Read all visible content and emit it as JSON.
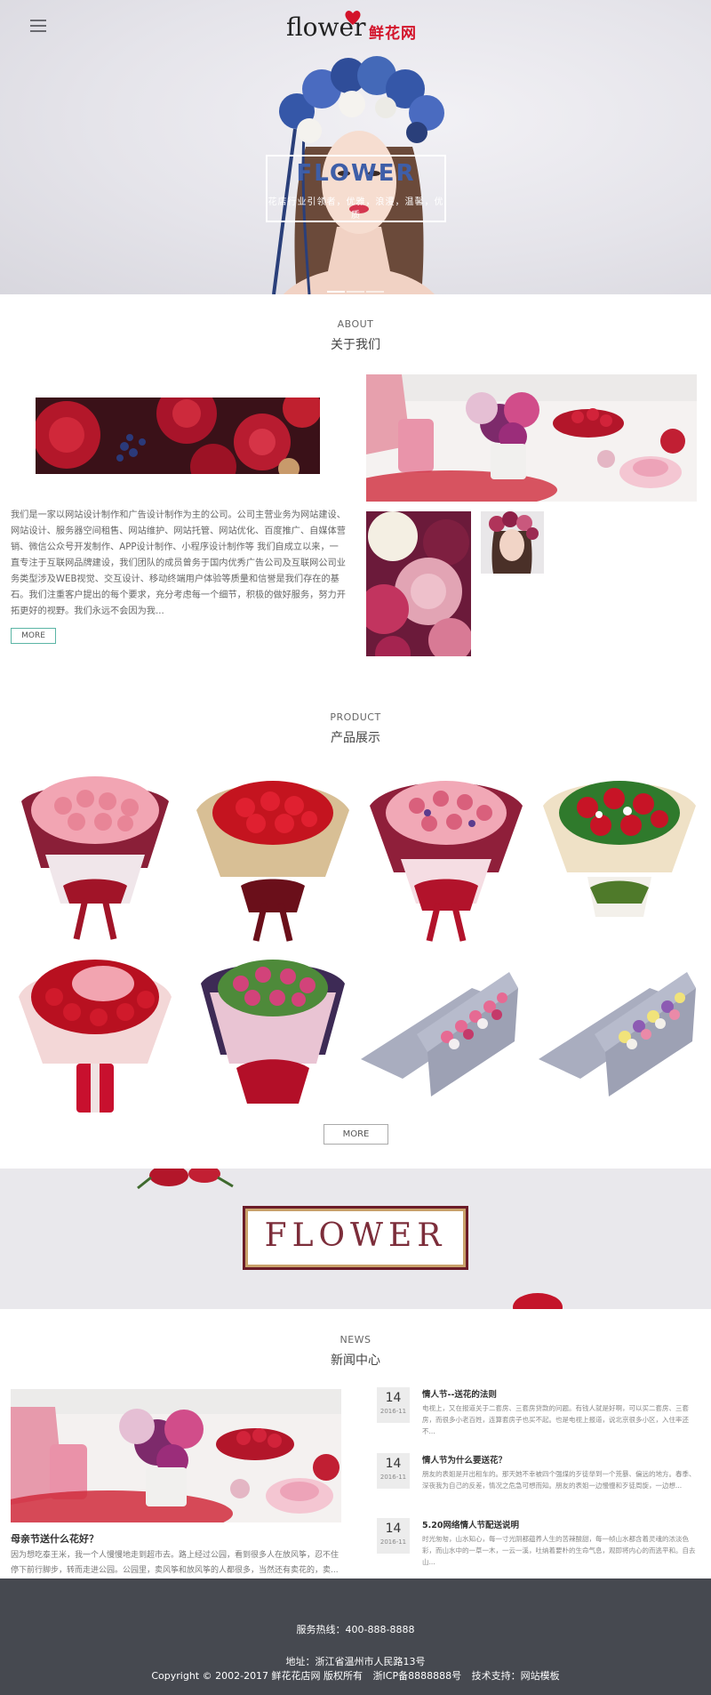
{
  "header": {
    "logo_latin": "flower",
    "logo_cn": "鲜花网",
    "colors": {
      "logo_red": "#d3132a"
    }
  },
  "hero": {
    "caption_title": "FLOWER",
    "caption_sub": "花店行业引领者，优雅，浪漫，温馨，优质",
    "slides": 3,
    "active_slide": 1
  },
  "about": {
    "heading_en": "ABOUT",
    "heading_cn": "关于我们",
    "text": "我们是一家以网站设计制作和广告设计制作为主的公司。公司主营业务为网站建设、网站设计、服务器空间租售、网站维护、网站托管、网站优化、百度推广、自媒体营销、微信公众号开发制作、APP设计制作、小程序设计制作等 我们自成立以来，一直专注于互联网品牌建设，我们团队的成员曾务于国内优秀广告公司及互联网公司业务类型涉及WEB视觉、交互设计、移动终端用户体验等质量和信誉是我们存在的基石。我们注重客户提出的每个要求，充分考虑每一个细节，积极的做好服务，努力开拓更好的视野。我们永远不会因为我...",
    "more": "MORE"
  },
  "product": {
    "heading_en": "PRODUCT",
    "heading_cn": "产品展示",
    "more": "MORE",
    "items": [
      {
        "icon": "pink-carnation-bouquet-icon"
      },
      {
        "icon": "red-carnation-bouquet-icon"
      },
      {
        "icon": "mixed-carnation-bouquet-icon"
      },
      {
        "icon": "red-rose-bouquet-icon"
      },
      {
        "icon": "red-pink-rose-bouquet-icon"
      },
      {
        "icon": "pink-lily-bouquet-icon"
      },
      {
        "icon": "pink-flower-box-icon"
      },
      {
        "icon": "mixed-flower-box-icon"
      }
    ]
  },
  "banner": {
    "word": "FLOWER"
  },
  "news": {
    "heading_en": "NEWS",
    "heading_cn": "新闻中心",
    "featured": {
      "title": "母亲节送什么花好？",
      "desc": "因为想吃泰王米，我一个人慢慢地走到超市去。路上经过公园，看到很多人在放风筝，忍不住停下前行脚步，转而走进公园。公园里，卖风筝和放风筝的人都很多，当然还有卖花的，卖..."
    },
    "items": [
      {
        "day": "14",
        "ym": "2016-11",
        "title": "情人节--送花的法则",
        "desc": "电视上，又在报道关于二套房、三套房贷款的问题。有钱人就是好啊，可以买二套房、三套房，而很多小老百姓，连算套房子也买不起。也是电视上报道，说北京很多小区，入住率还不..."
      },
      {
        "day": "14",
        "ym": "2016-11",
        "title": "情人节为什么要送花？",
        "desc": "朋友的表姐是开出租车的。那天她不幸被四个强煤的歹徒举到一个荒暴、偏远的地方。春季、深夜我为自己的反差，情况之危急可想而知。朋友的表姐一边慢慢和歹徒周旋，一边想..."
      },
      {
        "day": "14",
        "ym": "2016-11",
        "title": "5.20网络情人节配送说明",
        "desc": "时光匆匆，山水知心，每一寸光阴都蕴养人生的苦辣酸甜，每一帧山水都含着灵魂的浓淡色彩，而山水中的一草一木，一云一溪，吐纳着要朴的生命气息，观即将内心的而逃平和。自去山..."
      }
    ]
  },
  "footer": {
    "hotline": "服务热线：400-888-8888",
    "address": "地址：浙江省温州市人民路13号",
    "copyright": "Copyright © 2002-2017 鲜花花店网 版权所有",
    "icp": "浙ICP备8888888号",
    "support": "技术支持：网站模板",
    "colors": {
      "footer_bg": "#464950"
    }
  }
}
